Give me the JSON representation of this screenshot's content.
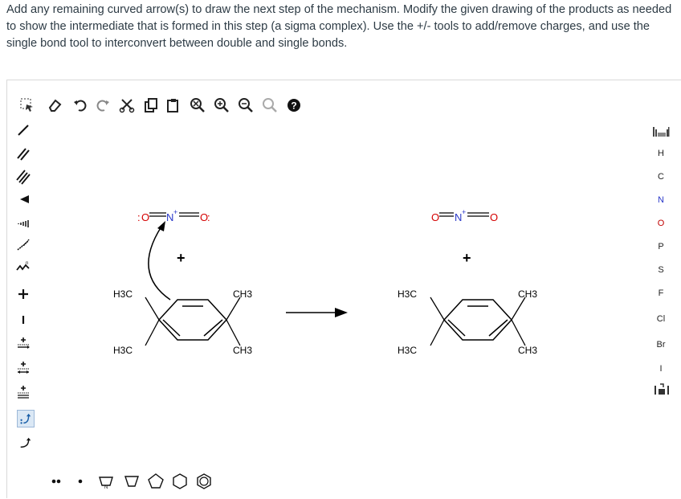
{
  "question": {
    "text": "Add any remaining curved arrow(s) to draw the next step of the mechanism. Modify the given drawing of the products as needed to show the intermediate that is formed in this step (a sigma complex). Use the +/- tools to add/remove charges, and use the single bond tool to interconvert between double and single bonds."
  },
  "toolbar_top": [
    {
      "name": "selection-icon"
    },
    {
      "name": "eraser-icon"
    },
    {
      "name": "undo-icon"
    },
    {
      "name": "redo-icon"
    },
    {
      "name": "cut-icon"
    },
    {
      "name": "copy-icon"
    },
    {
      "name": "paste-icon"
    },
    {
      "name": "zoom-fit-icon"
    },
    {
      "name": "zoom-in-icon"
    },
    {
      "name": "zoom-out-icon"
    },
    {
      "name": "clean-icon"
    },
    {
      "name": "help-icon"
    }
  ],
  "toolbar_left": [
    {
      "name": "single-bond-icon"
    },
    {
      "name": "double-bond-icon"
    },
    {
      "name": "triple-bond-icon"
    },
    {
      "name": "wedge-bond-icon"
    },
    {
      "name": "hash-bond-icon"
    },
    {
      "name": "wavy-bond-icon"
    },
    {
      "name": "chain-icon"
    },
    {
      "name": "plus-charge-icon"
    },
    {
      "name": "minus-charge-icon"
    },
    {
      "name": "plus-minus-arrow-icon"
    },
    {
      "name": "electron-pair-arrow-icon"
    },
    {
      "name": "radical-arrow-icon"
    },
    {
      "name": "curved-arrow-pair-icon"
    },
    {
      "name": "curved-arrow-single-icon"
    }
  ],
  "elements": [
    "H",
    "C",
    "N",
    "O",
    "P",
    "S",
    "F",
    "Cl",
    "Br",
    "I"
  ],
  "canvas": {
    "left_molecule": {
      "no2_label": "O=N=O",
      "plus": "+",
      "h3c_top": "H3C",
      "ch3_top": "CH3",
      "h3c_bottom": "H3C",
      "ch3_bottom": "CH3"
    },
    "right_molecule": {
      "no2_label": "O=N=O",
      "plus": "+",
      "h3c_top": "H3C",
      "ch3_top": "CH3",
      "h3c_bottom": "H3C",
      "ch3_bottom": "CH3"
    },
    "colors": {
      "oxygen": "#d40000",
      "nitrogen": "#2a38c9",
      "bond": "#000000"
    }
  },
  "bottom_toolbar": [
    {
      "name": "lone-pair-icon"
    },
    {
      "name": "radical-icon"
    },
    {
      "name": "pyrrole-icon"
    },
    {
      "name": "cyclopropane-icon"
    },
    {
      "name": "cyclopentane-icon"
    },
    {
      "name": "cyclohexane-icon"
    },
    {
      "name": "benzene-icon"
    }
  ]
}
